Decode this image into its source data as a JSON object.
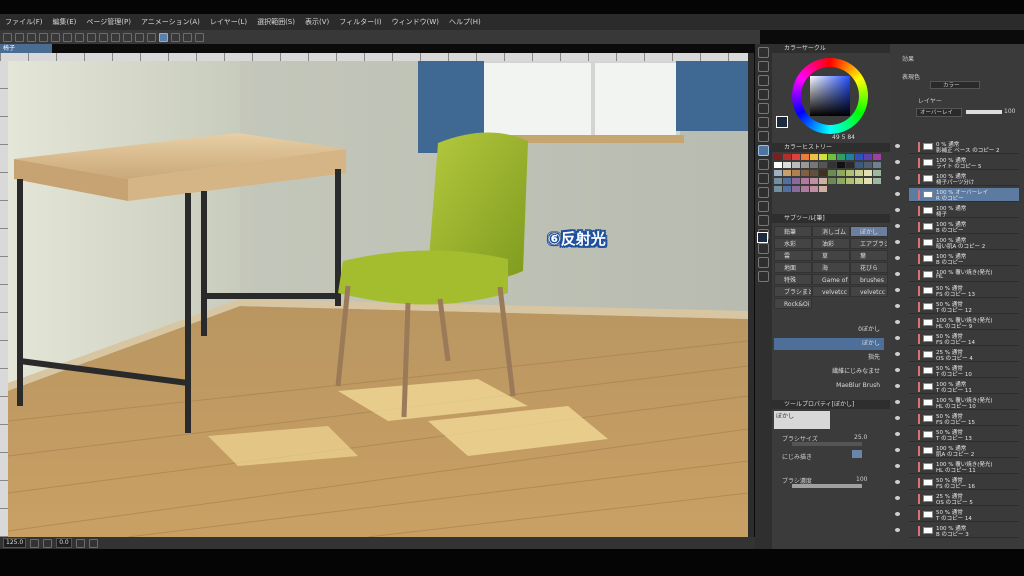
{
  "menubar": {
    "items": [
      "ファイル(F)",
      "編集(E)",
      "ページ管理(P)",
      "アニメーション(A)",
      "レイヤー(L)",
      "選択範囲(S)",
      "表示(V)",
      "フィルター(I)",
      "ウィンドウ(W)",
      "ヘルプ(H)"
    ]
  },
  "canvas_tab": {
    "label": "椅子"
  },
  "canvas": {
    "annotation": "⑥反射光"
  },
  "statusbar": {
    "zoom": "125.0",
    "angle": "0.0"
  },
  "color_panel": {
    "title": "カラーサークル",
    "hsv_values": [
      "49",
      "5",
      "84"
    ],
    "history_title": "カラーヒストリー",
    "fg_color": "#1b2a3f",
    "bg_color": "#ffffff",
    "swatches": [
      "#7a1f1f",
      "#b03030",
      "#e04040",
      "#f07a3a",
      "#f0c040",
      "#d0e040",
      "#70c040",
      "#30a060",
      "#2080a0",
      "#3050c0",
      "#6040b0",
      "#a040a0",
      "#ffffff",
      "#dddddd",
      "#bbbbbb",
      "#999999",
      "#777777",
      "#555555",
      "#333333",
      "#111111",
      "#2a2a2a",
      "#3c5a80",
      "#506070",
      "#708090",
      "#a0b0c0",
      "#c8a070",
      "#b08050",
      "#806040",
      "#605040",
      "#403020"
    ]
  },
  "subtool_panel": {
    "title": "サブツール[筆]",
    "left_items": [
      "鉛筆",
      "水彩",
      "雲",
      "地面",
      "特殊",
      "ブラシまと",
      "Rock&Oi"
    ],
    "mid_items": [
      "消しゴム",
      "油彩",
      "草",
      "海",
      "Game of",
      "velvetcc"
    ],
    "right_items": [
      "ぼかし",
      "エアブラシ",
      "葉",
      "花びら",
      "brushes",
      "velvetcc"
    ],
    "brushes": [
      "0ぼかし",
      "ぼかし",
      "指先",
      "繊維にじみなませ",
      "MaeBlur Brush"
    ],
    "selected_brush_index": 1
  },
  "tool_property": {
    "title": "ツールプロパティ[ぼかし]",
    "tool_name": "ぼかし",
    "brush_size_label": "ブラシサイズ",
    "brush_size_value": "25.0",
    "blend_label": "にじみ描き",
    "density_label": "ブラシ濃度",
    "density_value": "100"
  },
  "layer_panel": {
    "effect_label": "効果",
    "color_mode_label": "表現色",
    "color_mode_value": "カラー",
    "layer_tab": "レイヤー",
    "blend_mode": "オーバーレイ",
    "opacity": "100",
    "layers": [
      {
        "line1": "0 % 通常",
        "line2": "影補正 ベース のコピー 2"
      },
      {
        "line1": "100 % 通常",
        "line2": "ライト のコピー 5"
      },
      {
        "line1": "100 % 通常",
        "line2": "椅子パーツ分け"
      },
      {
        "line1": "100 % オーバーレイ",
        "line2": "R のコピー",
        "selected": true
      },
      {
        "line1": "100 % 通常",
        "line2": "椅子"
      },
      {
        "line1": "100 % 通常",
        "line2": "B のコピー"
      },
      {
        "line1": "100 % 通常",
        "line2": "暗い肌A のコピー 2"
      },
      {
        "line1": "100 % 通常",
        "line2": "B のコピー"
      },
      {
        "line1": "100 % 覆い焼き(発光)",
        "line2": "HL"
      },
      {
        "line1": "50 % 通常",
        "line2": "FS のコピー 13"
      },
      {
        "line1": "50 % 通常",
        "line2": "T のコピー 12"
      },
      {
        "line1": "100 % 覆い焼き(発光)",
        "line2": "HL のコピー 9"
      },
      {
        "line1": "50 % 通常",
        "line2": "FS のコピー 14"
      },
      {
        "line1": "25 % 通常",
        "line2": "OS のコピー 4"
      },
      {
        "line1": "50 % 通常",
        "line2": "T のコピー 10"
      },
      {
        "line1": "100 % 通常",
        "line2": "T のコピー 11"
      },
      {
        "line1": "100 % 覆い焼き(発光)",
        "line2": "HL のコピー 10"
      },
      {
        "line1": "50 % 通常",
        "line2": "FS のコピー 15"
      },
      {
        "line1": "50 % 通常",
        "line2": "T のコピー 13"
      },
      {
        "line1": "100 % 通常",
        "line2": "肌A のコピー 2"
      },
      {
        "line1": "100 % 覆い焼き(発光)",
        "line2": "HL のコピー 11"
      },
      {
        "line1": "50 % 通常",
        "line2": "FS のコピー 16"
      },
      {
        "line1": "25 % 通常",
        "line2": "OS のコピー 5"
      },
      {
        "line1": "50 % 通常",
        "line2": "T のコピー 14"
      },
      {
        "line1": "100 % 通常",
        "line2": "B のコピー 3"
      }
    ]
  }
}
